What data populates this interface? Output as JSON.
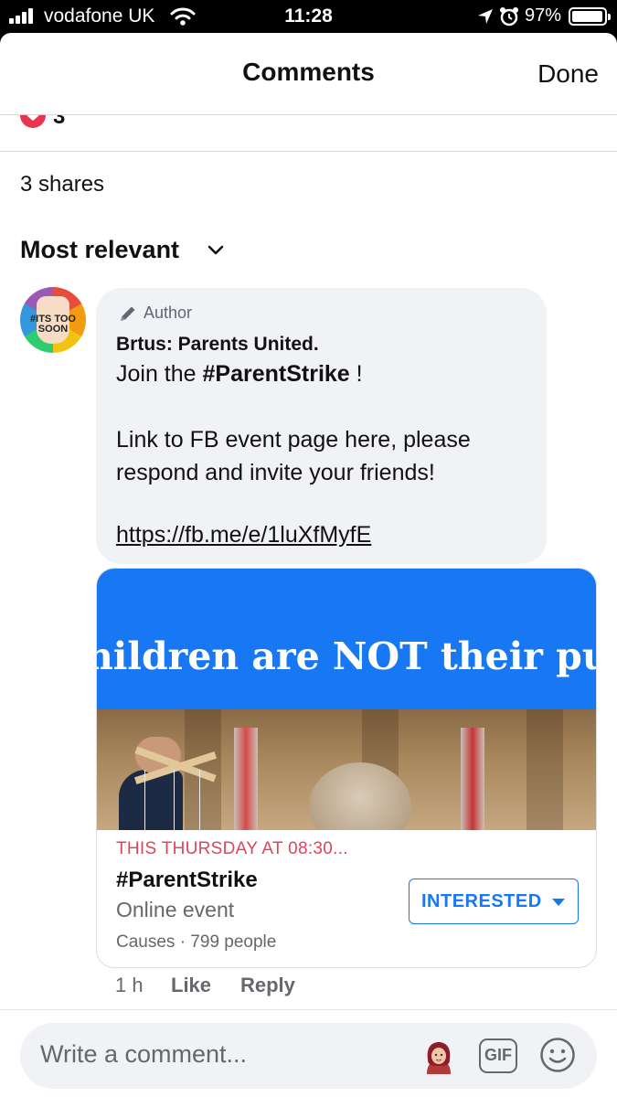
{
  "status_bar": {
    "carrier": "vodafone UK",
    "time": "11:28",
    "battery": "97%",
    "icons": [
      "signal-icon",
      "wifi-icon",
      "location-icon",
      "alarm-icon",
      "battery-icon"
    ]
  },
  "header": {
    "title": "Comments",
    "done_label": "Done"
  },
  "post_stats": {
    "reaction_icon": "heart-icon",
    "reaction_count": "3",
    "shares": "3 shares"
  },
  "sort": {
    "label": "Most relevant",
    "icon": "chevron-down-icon"
  },
  "comment": {
    "avatar_text": "#ITS TOO SOON",
    "badge": "Author",
    "author": "Brtus: Parents United.",
    "line1_prefix": "Join the ",
    "line1_tag": "#ParentStrike",
    "line1_suffix": " !",
    "line2": "Link to FB event page here, please",
    "line3": "respond and invite your friends!",
    "link": "https://fb.me/e/1luXfMyfE",
    "time": "1 h",
    "like_label": "Like",
    "reply_label": "Reply"
  },
  "event": {
    "banner_text": "hildren are NOT their pup",
    "date": "THIS THURSDAY AT 08:30...",
    "title": "#ParentStrike",
    "type": "Online event",
    "meta": "Causes · 799 people",
    "button_label": "INTERESTED",
    "accent_color": "#1877f2",
    "date_color": "#e0445e"
  },
  "composer": {
    "placeholder": "Write a comment...",
    "gif_label": "GIF",
    "icons": [
      "avatar-sticker-icon",
      "gif-icon",
      "emoji-icon"
    ]
  }
}
